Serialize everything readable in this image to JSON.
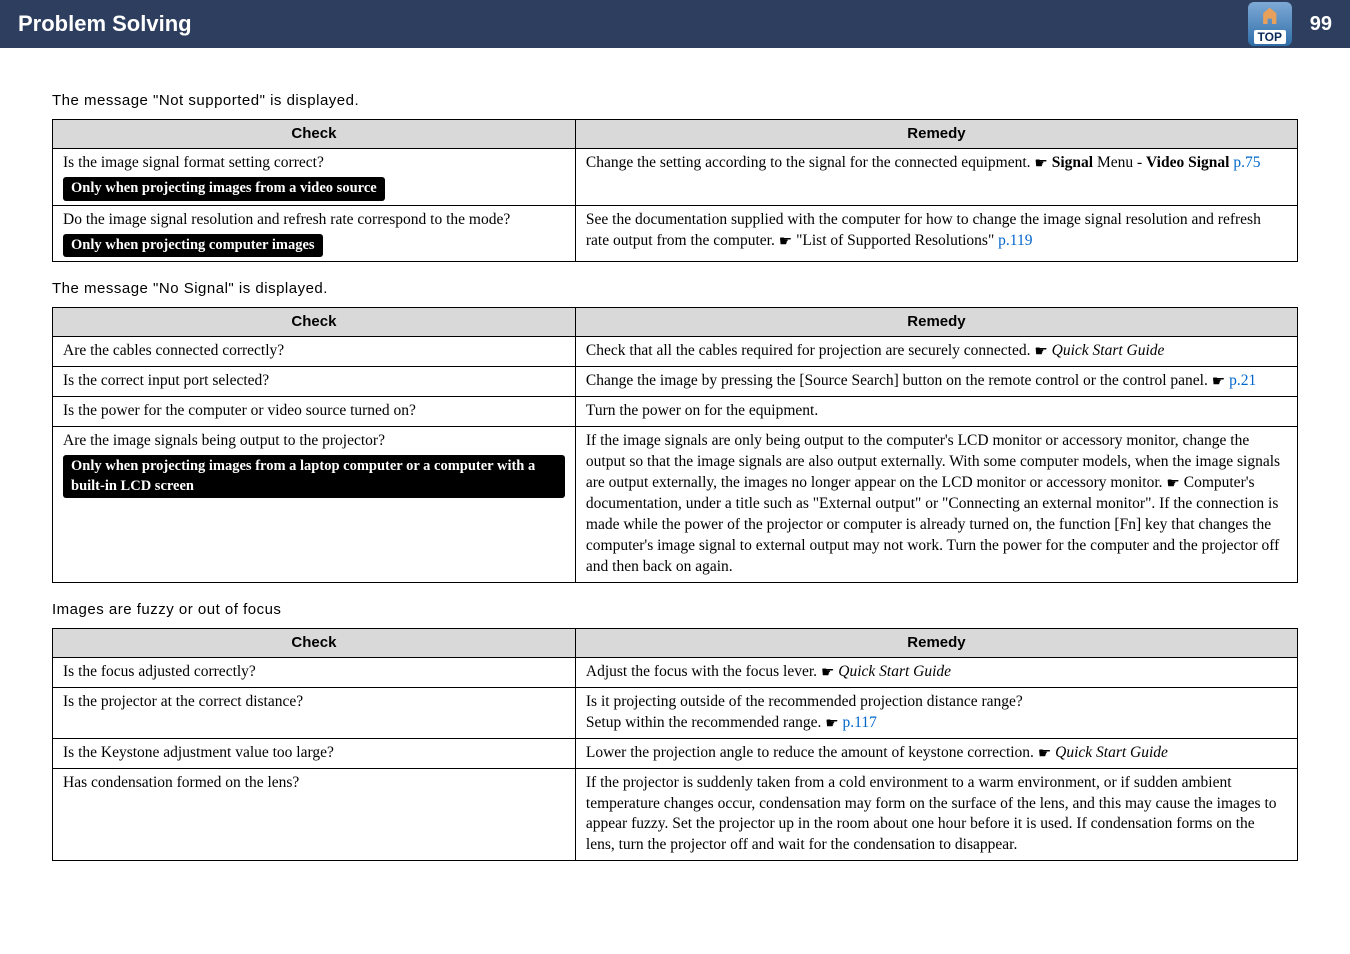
{
  "header": {
    "title": "Problem Solving",
    "top_label": "TOP",
    "page_number": "99"
  },
  "sections": [
    {
      "heading": "The message \"Not supported\" is displayed.",
      "columns": {
        "check": "Check",
        "remedy": "Remedy"
      },
      "rows": [
        {
          "check": "Is the image signal format setting correct?",
          "pill": "Only when projecting images from a video source",
          "remedy_pre": "Change the setting according to the signal for the connected equipment. ",
          "remedy_bold1": "Signal",
          "remedy_mid": " Menu - ",
          "remedy_bold2": "Video Signal",
          "remedy_space": " ",
          "remedy_link": "p.75"
        },
        {
          "check": "Do the image signal resolution and refresh rate correspond to the mode?",
          "pill": "Only when projecting computer images",
          "remedy_pre": "See the documentation supplied with the computer for how to change the image signal resolution and refresh rate output from the computer. ",
          "remedy_quote": " \"List of Supported Resolutions\" ",
          "remedy_link": "p.119"
        }
      ]
    },
    {
      "heading": "The message \"No Signal\" is displayed.",
      "columns": {
        "check": "Check",
        "remedy": "Remedy"
      },
      "rows": [
        {
          "check": "Are the cables connected correctly?",
          "remedy_pre": "Check that all the cables required for projection are securely connected. ",
          "remedy_italic": " Quick Start Guide"
        },
        {
          "check": "Is the correct input port selected?",
          "remedy_pre": "Change the image by pressing the [Source Search] button on the remote control or the control panel. ",
          "remedy_link": "p.21"
        },
        {
          "check": "Is the power for the computer or video source turned on?",
          "remedy_pre": "Turn the power on for the equipment."
        },
        {
          "check": "Are the image signals being output to the projector?",
          "pill": "Only when projecting images from a laptop computer or a computer with a built-in LCD screen",
          "remedy_pre": "If the image signals are only being output to the computer's LCD monitor or accessory monitor, change the output so that the image signals are also output externally. With some computer models, when the image signals are output externally, the images no longer appear on the LCD monitor or accessory monitor. ",
          "remedy_post": " Computer's documentation, under a title such as \"External output\" or \"Connecting an external monitor\". If the connection is made while the power of the projector or computer is already turned on, the function [Fn] key that changes the computer's image signal to external output may not work. Turn the power for the computer and the projector off and then back on again."
        }
      ]
    },
    {
      "heading": "Images are fuzzy or out of focus",
      "columns": {
        "check": "Check",
        "remedy": "Remedy"
      },
      "rows": [
        {
          "check": "Is the focus adjusted correctly?",
          "remedy_pre": "Adjust the focus with the focus lever. ",
          "remedy_italic": " Quick Start Guide"
        },
        {
          "check": "Is the projector at the correct distance?",
          "remedy_line1": "Is it projecting outside of the recommended projection distance range?",
          "remedy_line2_pre": "Setup within the recommended range. ",
          "remedy_link": "p.117"
        },
        {
          "check": "Is the Keystone adjustment value too large?",
          "remedy_pre": "Lower the projection angle to reduce the amount of keystone correction. ",
          "remedy_italic": " Quick Start Guide"
        },
        {
          "check": "Has condensation formed on the lens?",
          "remedy_pre": "If the projector is suddenly taken from a cold environment to a warm environment, or if sudden ambient temperature changes occur, condensation may form on the surface of the lens, and this may cause the images to appear fuzzy. Set the projector up in the room about one hour before it is used. If condensation forms on the lens, turn the projector off and wait for the condensation to disappear."
        }
      ]
    }
  ]
}
